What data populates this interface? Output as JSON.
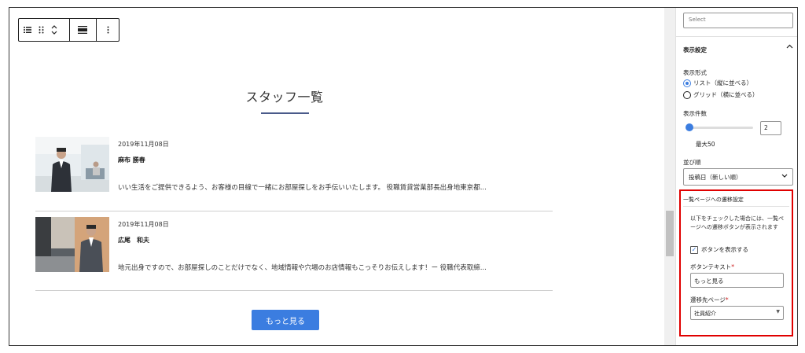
{
  "sidebar": {
    "select_placeholder": "Select",
    "display_settings_title": "表示設定",
    "display_format_label": "表示形式",
    "radio_list": "リスト（縦に並べる）",
    "radio_grid": "グリッド（横に並べる）",
    "count_label": "表示件数",
    "count_value": "2",
    "count_slider_fraction": 0.04,
    "max_label": "最大50",
    "order_label": "並び順",
    "order_value": "投稿日（新しい順）",
    "link_section_title": "一覧ページへの遷移設定",
    "link_note": "以下をチェックした場合には、一覧ページへの遷移ボタンが表示されます",
    "show_button_label": "ボタンを表示する",
    "button_text_label": "ボタンテキスト",
    "button_text_value": "もっと見る",
    "dest_page_label": "遷移先ページ",
    "dest_page_value": "社員紹介",
    "required_mark": "*"
  },
  "main": {
    "title": "スタッフ一覧",
    "staff": [
      {
        "date": "2019年11月08日",
        "name": "麻布 勝春",
        "desc": "いい生活をご提供できるよう、お客様の目線で一緒にお部屋探しをお手伝いいたします。 役職賃貸営業部長出身地東京都..."
      },
      {
        "date": "2019年11月08日",
        "name": "広尾　和夫",
        "desc": "地元出身ですので、お部屋探しのことだけでなく、地域情報や穴場のお店情報もこっそりお伝えします！ー 役職代表取締..."
      }
    ],
    "more_button": "もっと見る"
  },
  "colors": {
    "accent": "#3b7de0",
    "highlight_border": "#e00000"
  }
}
